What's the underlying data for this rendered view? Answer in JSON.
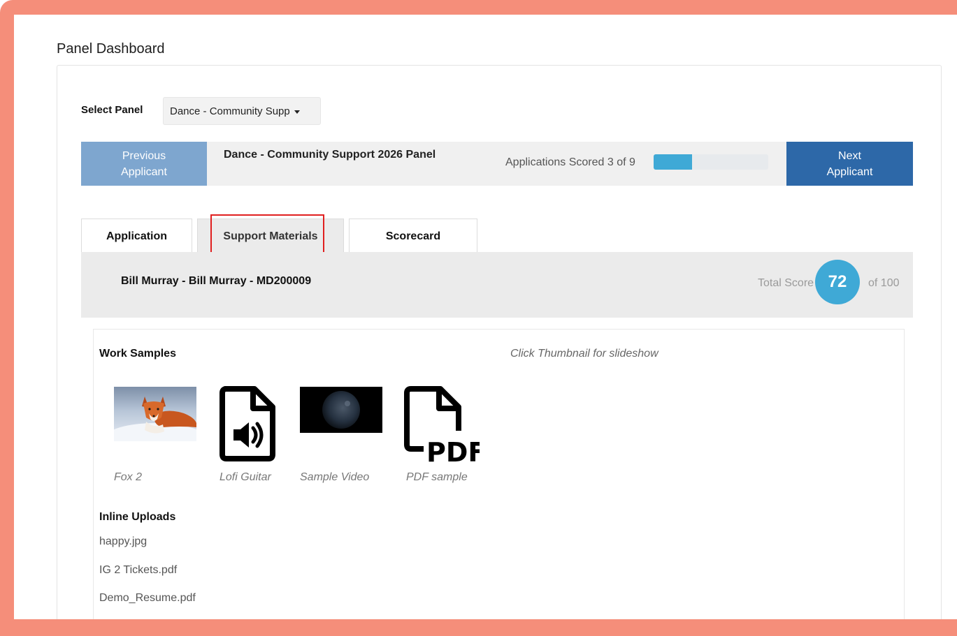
{
  "page": {
    "title": "Panel Dashboard"
  },
  "panel_select": {
    "label": "Select Panel",
    "value": "Dance - Community Supp"
  },
  "navigation": {
    "previous_label": "Previous\nApplicant",
    "next_label": "Next\nApplicant",
    "panel_name": "Dance - Community Support 2026 Panel",
    "scored_text": "Applications Scored 3 of 9",
    "scored": 3,
    "total": 9
  },
  "tabs": [
    {
      "label": "Application"
    },
    {
      "label": "Support Materials",
      "active": true
    },
    {
      "label": "Scorecard"
    }
  ],
  "applicant": {
    "name": "Bill Murray - Bill Murray - MD200009",
    "total_score_label": "Total Score",
    "score": "72",
    "of_total": "of 100"
  },
  "work_samples": {
    "title": "Work Samples",
    "hint": "Click Thumbnail for slideshow",
    "items": [
      {
        "caption": "Fox 2",
        "icon": "fox-photo-thumbnail"
      },
      {
        "caption": "Lofi Guitar",
        "icon": "audio-file-icon"
      },
      {
        "caption": "Sample Video",
        "icon": "video-thumbnail"
      },
      {
        "caption": "PDF sample",
        "icon": "pdf-file-icon"
      }
    ]
  },
  "inline_uploads": {
    "title": "Inline Uploads",
    "files": [
      "happy.jpg",
      "IG 2 Tickets.pdf",
      "Demo_Resume.pdf"
    ]
  },
  "colors": {
    "frame": "#f58e7a",
    "previous_button": "#7ea6cf",
    "next_button": "#2d68a8",
    "progress": "#3fa9d6",
    "score_badge": "#3fa9d6",
    "highlight": "#e02020"
  }
}
